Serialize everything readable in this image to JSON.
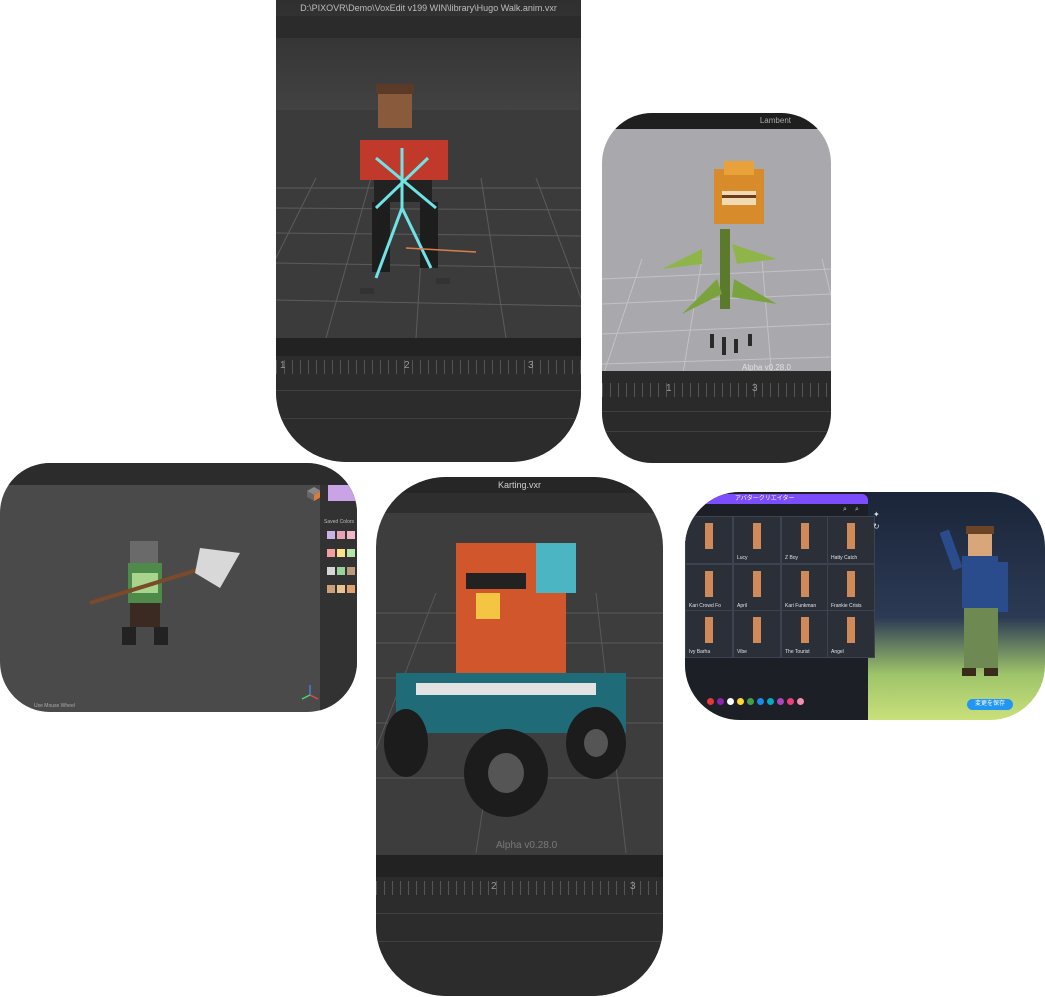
{
  "card1": {
    "title": "D:\\PIXOVR\\Demo\\VoxEdit v199 WIN\\library\\Hugo Walk.anim.vxr",
    "ticks": [
      "1",
      "2",
      "3"
    ]
  },
  "card2": {
    "title": "Lambent",
    "version": "Alpha v0.28.0",
    "ticks": [
      "1",
      "3"
    ]
  },
  "card3": {
    "palette_label": "Saved Colors",
    "status": "Use Mouse Wheel",
    "palette_colors": [
      "#c9b3e6",
      "#e6a3b8",
      "#f2b6c6",
      "#f0a0a0",
      "#ffe08a",
      "#b6e3a8",
      "#d6d6d6",
      "#9bd19b",
      "#b99a7a",
      "#c9a078",
      "#e8c290",
      "#e0a070"
    ]
  },
  "card4": {
    "title": "Karting.vxr",
    "version": "Alpha v0.28.0",
    "ticks": [
      "2",
      "3"
    ]
  },
  "card5": {
    "header": "アバタークリエイター",
    "avatars": [
      "Lucy",
      "Z Boy",
      "Hatty Catch",
      "Kari Crowd Fo",
      "April",
      "Kari Funkman",
      "Frankie Crisis",
      "Ivy Barha",
      "Vibe",
      "The Tourist",
      "Angel"
    ],
    "save_button": "変更を保存",
    "dot_colors": [
      "#e53935",
      "#8e24aa",
      "#ffffff",
      "#fdd835",
      "#43a047",
      "#1e88e5",
      "#00acc1",
      "#ab47bc",
      "#ec407a",
      "#f48fb1"
    ]
  }
}
